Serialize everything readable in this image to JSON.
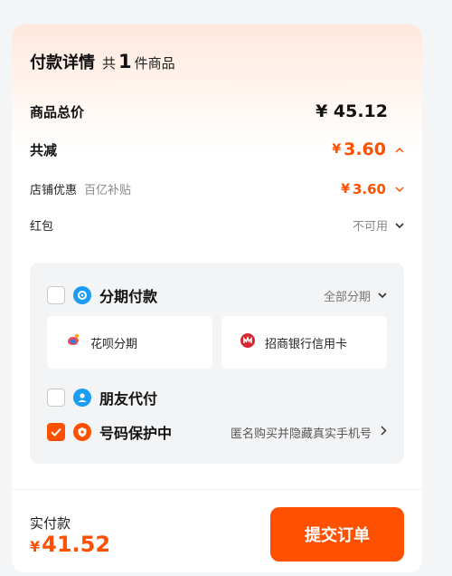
{
  "header": {
    "title": "付款详情",
    "count_prefix": "共",
    "count": "1",
    "count_suffix": "件商品"
  },
  "summary": {
    "total_label": "商品总价",
    "total_amount": "¥ 45.12",
    "reduce_label": "共减",
    "reduce_currency": "¥",
    "reduce_amount": "3.60",
    "shop_discount_label": "店铺优惠",
    "shop_discount_sub": "百亿补贴",
    "shop_discount_currency": "¥",
    "shop_discount_amount": "3.60",
    "redpack_label": "红包",
    "redpack_status": "不可用"
  },
  "payment_options": {
    "installment_label": "分期付款",
    "installment_action": "全部分期",
    "options": [
      {
        "label": "花呗分期",
        "icon": "huabei-icon"
      },
      {
        "label": "招商银行信用卡",
        "icon": "cmb-bank-icon"
      }
    ],
    "friend_pay_label": "朋友代付",
    "number_protect_label": "号码保护中",
    "number_protect_desc": "匿名购买并隐藏真实手机号"
  },
  "footer": {
    "pay_label": "实付款",
    "pay_currency": "¥",
    "pay_amount": "41.52",
    "submit_label": "提交订单"
  },
  "colors": {
    "accent": "#ff5000",
    "installment_icon": "#1b9cf5",
    "friend_icon": "#1b9cf5",
    "protect_icon": "#ff5000",
    "cmb_red": "#d7262f"
  }
}
